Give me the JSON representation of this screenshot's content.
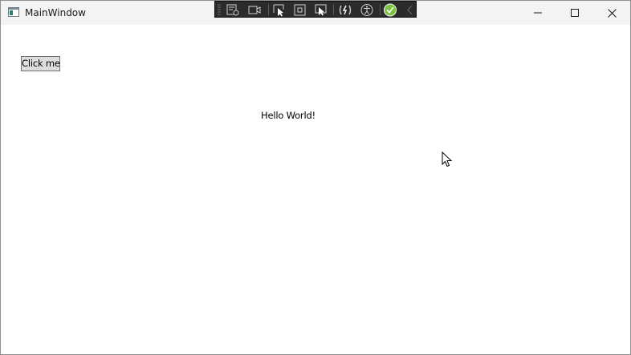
{
  "window": {
    "title": "MainWindow",
    "app_icon": "window-app-icon",
    "caption_buttons": [
      "minimize-icon",
      "maximize-icon",
      "close-icon"
    ]
  },
  "dev_toolbar": {
    "tools": [
      "live-visual-tree-icon",
      "video-camera-icon",
      "select-element-icon",
      "display-layout-adorners-icon",
      "track-focused-element-icon",
      "hot-reload-icon",
      "accessibility-icon",
      "binding-failures-check-icon",
      "collapse-chevron-icon"
    ]
  },
  "content": {
    "button_label": "Click me",
    "message": "Hello World!"
  },
  "colors": {
    "titlebar": "#f3f3f3",
    "toolbar": "#2b2b2b",
    "toolbar_check": "#7cc242",
    "button_face": "#dddddd",
    "button_border": "#707070"
  }
}
